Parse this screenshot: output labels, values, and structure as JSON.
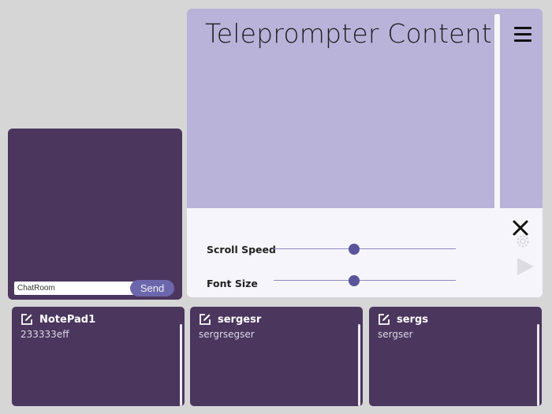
{
  "teleprompter": {
    "title": "Teleprompter Content",
    "scroll_speed_label": "Scroll Speed",
    "font_size_label": "Font Size",
    "scroll_speed_value": 0.44,
    "font_size_value": 0.44,
    "icons": [
      "menu-icon",
      "close-icon",
      "gear-icon",
      "play-icon"
    ]
  },
  "chat": {
    "input_value": "ChatRoom",
    "send_label": "Send"
  },
  "notepads": [
    {
      "title": "NotePad1",
      "content": "233333eff"
    },
    {
      "title": "sergesr",
      "content": "sergrsegser"
    },
    {
      "title": "sergs",
      "content": "sergser"
    }
  ],
  "colors": {
    "background": "#d6d6d6",
    "teleprompter_bg": "#b9b3da",
    "panel_dark": "#4b365e",
    "accent": "#6c67ad",
    "slider_knob": "#5a559a"
  }
}
